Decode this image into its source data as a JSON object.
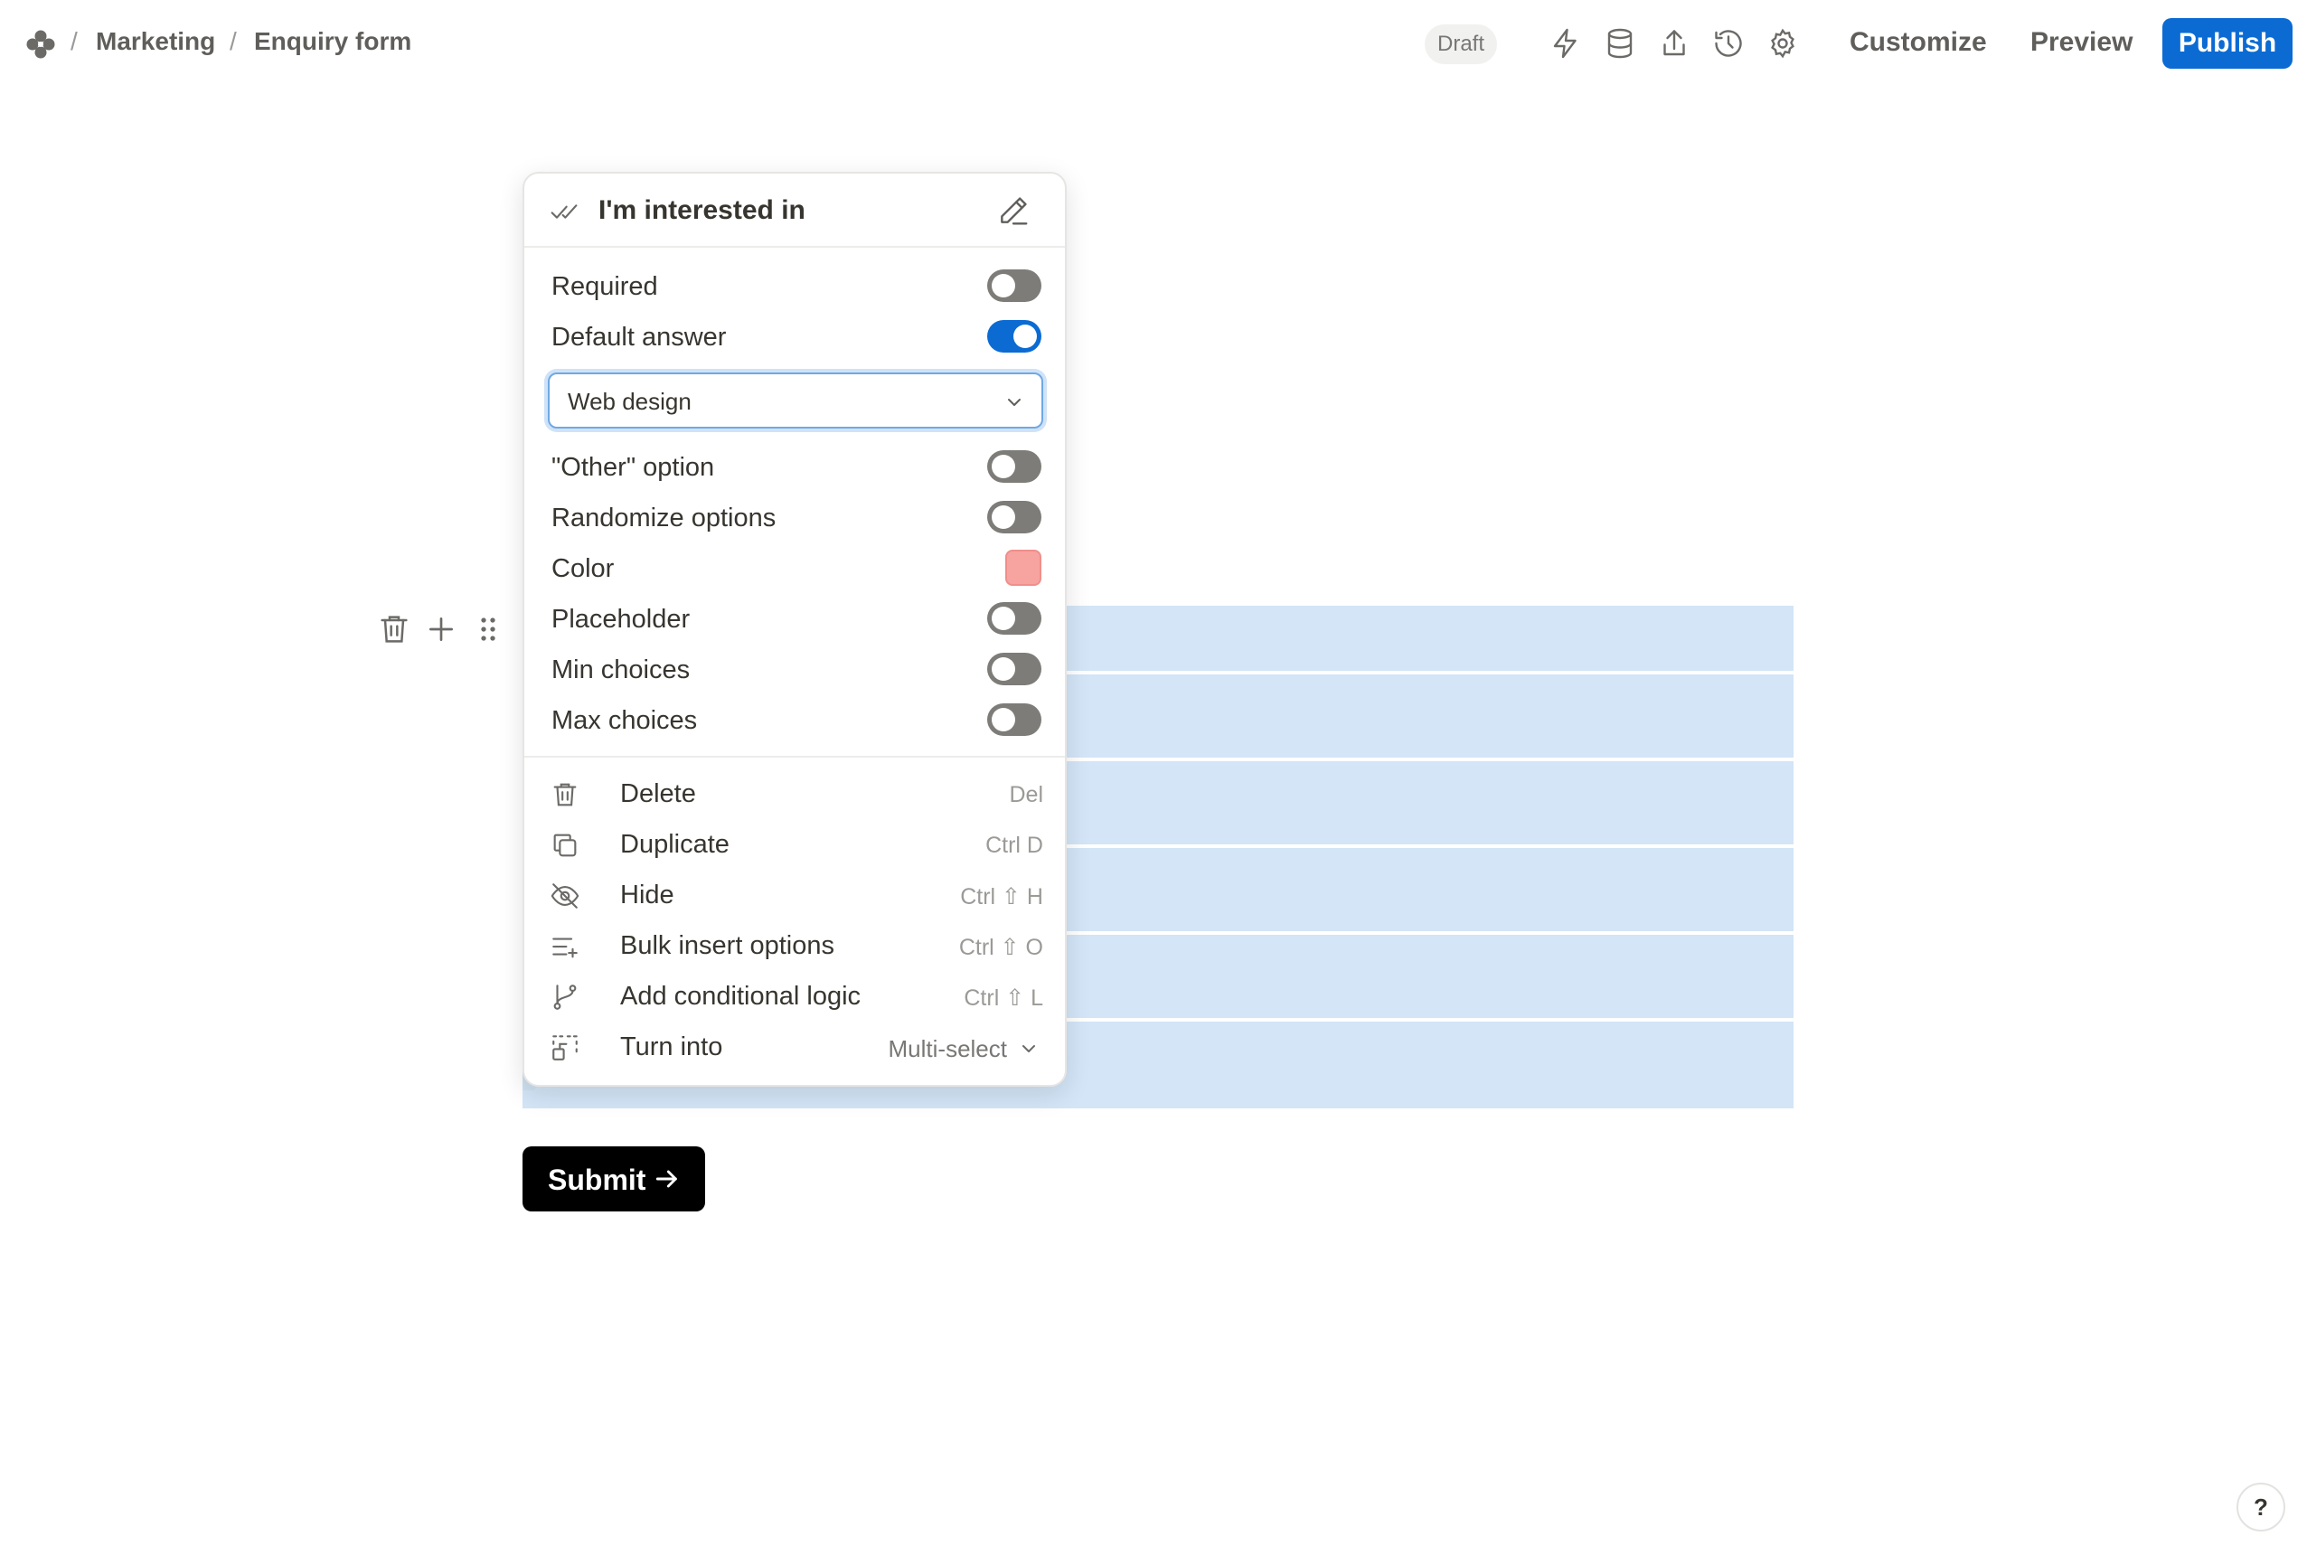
{
  "breadcrumb": {
    "logo_icon": "pinwheel-logo-icon",
    "separator": "/",
    "items": [
      "Marketing",
      "Enquiry form"
    ]
  },
  "toolbar": {
    "status_badge": "Draft",
    "icons": [
      "lightning-icon",
      "database-icon",
      "share-icon",
      "history-icon",
      "gear-icon"
    ],
    "customize_label": "Customize",
    "preview_label": "Preview",
    "publish_label": "Publish",
    "publish_color": "#0b6bd3"
  },
  "block_controls": {
    "icons": [
      "trash-icon",
      "plus-icon",
      "drag-handle-icon"
    ]
  },
  "popover": {
    "field_icon": "double-check-icon",
    "title": "I'm interested in",
    "edit_icon": "pencil-icon",
    "settings": {
      "required": {
        "label": "Required",
        "on": false
      },
      "default_answer": {
        "label": "Default answer",
        "on": true
      },
      "default_value": "Web design",
      "other_option": {
        "label": "\"Other\" option",
        "on": false
      },
      "randomize": {
        "label": "Randomize options",
        "on": false
      },
      "color": {
        "label": "Color",
        "value": "#f7a3a0"
      },
      "placeholder": {
        "label": "Placeholder",
        "on": false
      },
      "min_choices": {
        "label": "Min choices",
        "on": false
      },
      "max_choices": {
        "label": "Max choices",
        "on": false
      }
    },
    "actions": {
      "delete": {
        "label": "Delete",
        "shortcut": "Del",
        "icon": "trash-icon"
      },
      "duplicate": {
        "label": "Duplicate",
        "shortcut": "Ctrl D",
        "icon": "duplicate-icon"
      },
      "hide": {
        "label": "Hide",
        "shortcut": "Ctrl ⇧ H",
        "icon": "eye-off-icon"
      },
      "bulk_insert": {
        "label": "Bulk insert options",
        "shortcut": "Ctrl ⇧ O",
        "icon": "list-plus-icon"
      },
      "conditional": {
        "label": "Add conditional logic",
        "shortcut": "Ctrl ⇧ L",
        "icon": "branch-icon"
      },
      "turn_into": {
        "label": "Turn into",
        "value": "Multi-select",
        "icon": "convert-icon"
      }
    }
  },
  "form": {
    "submit_label": "Submit",
    "selection_color": "#d3e5f7"
  },
  "help_label": "?"
}
